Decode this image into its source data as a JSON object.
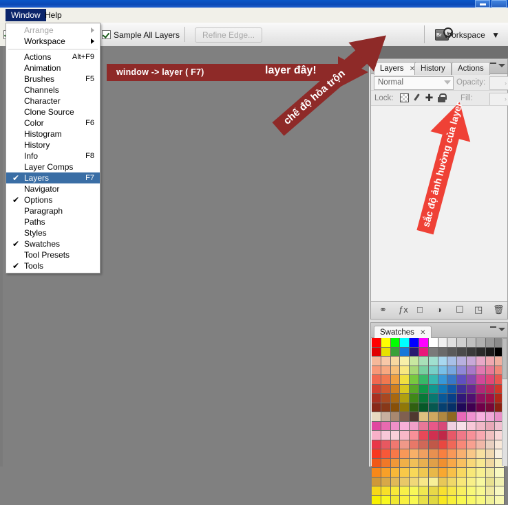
{
  "titlebar": {
    "restore_label": "",
    "close_label": ""
  },
  "menubar": {
    "items": [
      {
        "label": "Window",
        "active": true
      },
      {
        "label": "Help",
        "active": false
      }
    ]
  },
  "options_bar": {
    "sample_all_layers_label": "Sample All Layers",
    "sample_all_layers_checked": true,
    "refine_edge_label": "Refine Edge...",
    "refine_edge_disabled": true,
    "bridge_icon": "bridge-icon",
    "bridge_badge": "Br",
    "workspace_label": "Workspace",
    "workspace_caret": "chevron-down-icon"
  },
  "window_menu": {
    "items": [
      {
        "label": "Arrange",
        "shortcut": "",
        "checked": false,
        "disabled": true,
        "submenu": true,
        "selected": false
      },
      {
        "label": "Workspace",
        "shortcut": "",
        "checked": false,
        "disabled": false,
        "submenu": true,
        "selected": false
      },
      {
        "separator": true
      },
      {
        "label": "Actions",
        "shortcut": "Alt+F9",
        "checked": false,
        "disabled": false,
        "submenu": false,
        "selected": false
      },
      {
        "label": "Animation",
        "shortcut": "",
        "checked": false,
        "disabled": false,
        "submenu": false,
        "selected": false
      },
      {
        "label": "Brushes",
        "shortcut": "F5",
        "checked": false,
        "disabled": false,
        "submenu": false,
        "selected": false
      },
      {
        "label": "Channels",
        "shortcut": "",
        "checked": false,
        "disabled": false,
        "submenu": false,
        "selected": false
      },
      {
        "label": "Character",
        "shortcut": "",
        "checked": false,
        "disabled": false,
        "submenu": false,
        "selected": false
      },
      {
        "label": "Clone Source",
        "shortcut": "",
        "checked": false,
        "disabled": false,
        "submenu": false,
        "selected": false
      },
      {
        "label": "Color",
        "shortcut": "F6",
        "checked": false,
        "disabled": false,
        "submenu": false,
        "selected": false
      },
      {
        "label": "Histogram",
        "shortcut": "",
        "checked": false,
        "disabled": false,
        "submenu": false,
        "selected": false
      },
      {
        "label": "History",
        "shortcut": "",
        "checked": false,
        "disabled": false,
        "submenu": false,
        "selected": false
      },
      {
        "label": "Info",
        "shortcut": "F8",
        "checked": false,
        "disabled": false,
        "submenu": false,
        "selected": false
      },
      {
        "label": "Layer Comps",
        "shortcut": "",
        "checked": false,
        "disabled": false,
        "submenu": false,
        "selected": false
      },
      {
        "label": "Layers",
        "shortcut": "F7",
        "checked": true,
        "disabled": false,
        "submenu": false,
        "selected": true
      },
      {
        "label": "Navigator",
        "shortcut": "",
        "checked": false,
        "disabled": false,
        "submenu": false,
        "selected": false
      },
      {
        "label": "Options",
        "shortcut": "",
        "checked": true,
        "disabled": false,
        "submenu": false,
        "selected": false
      },
      {
        "label": "Paragraph",
        "shortcut": "",
        "checked": false,
        "disabled": false,
        "submenu": false,
        "selected": false
      },
      {
        "label": "Paths",
        "shortcut": "",
        "checked": false,
        "disabled": false,
        "submenu": false,
        "selected": false
      },
      {
        "label": "Styles",
        "shortcut": "",
        "checked": false,
        "disabled": false,
        "submenu": false,
        "selected": false
      },
      {
        "label": "Swatches",
        "shortcut": "",
        "checked": true,
        "disabled": false,
        "submenu": false,
        "selected": false
      },
      {
        "label": "Tool Presets",
        "shortcut": "",
        "checked": false,
        "disabled": false,
        "submenu": false,
        "selected": false
      },
      {
        "label": "Tools",
        "shortcut": "",
        "checked": true,
        "disabled": false,
        "submenu": false,
        "selected": false
      }
    ],
    "check_glyph": "✔"
  },
  "layers_panel": {
    "tabs": [
      {
        "label": "Layers",
        "active": true,
        "closable": true
      },
      {
        "label": "History",
        "active": false,
        "closable": false
      },
      {
        "label": "Actions",
        "active": false,
        "closable": false
      }
    ],
    "close_glyph": "✕",
    "blend_mode_value": "Normal",
    "opacity_label": "Opacity:",
    "opacity_value": "",
    "lock_label": "Lock:",
    "lock_icons": [
      "transparency-lock-icon",
      "image-lock-icon",
      "position-lock-icon",
      "all-lock-icon"
    ],
    "fill_label": "Fill:",
    "fill_value": "",
    "bottom_icons": [
      {
        "name": "link-layers-icon",
        "glyph": "⚭"
      },
      {
        "name": "layer-style-icon",
        "glyph": "ƒx"
      },
      {
        "name": "layer-mask-icon",
        "glyph": "□"
      },
      {
        "name": "adjustment-layer-icon",
        "glyph": "◑"
      },
      {
        "name": "new-group-icon",
        "glyph": "☐"
      },
      {
        "name": "new-layer-icon",
        "glyph": "◳"
      },
      {
        "name": "delete-layer-icon",
        "glyph": "🗑"
      }
    ]
  },
  "swatches_panel": {
    "tab_label": "Swatches",
    "close_glyph": "✕",
    "colors": [
      "#ff0000",
      "#ffff00",
      "#00ff00",
      "#00ffff",
      "#0000ff",
      "#ff00ff",
      "#ffffff",
      "#f0f0f0",
      "#e0e0e0",
      "#d0d0d0",
      "#c0c0c0",
      "#b0b0b0",
      "#9a9a9a",
      "#8a8a8a",
      "#e00000",
      "#e8e000",
      "#3aa03a",
      "#1878d8",
      "#2a1a70",
      "#e8187a",
      "#7a7a7a",
      "#6a6a6a",
      "#5a5a5a",
      "#4a4a4a",
      "#3a3a3a",
      "#2a2a2a",
      "#1a1a1a",
      "#000000",
      "#f6b89a",
      "#f8c8a8",
      "#f8d8a0",
      "#f8f0a8",
      "#c8e8a0",
      "#a8e0b8",
      "#a0e0d0",
      "#a8d8f0",
      "#a8c0e8",
      "#b8b0e0",
      "#c8a8d8",
      "#e8a8c8",
      "#f0a8b0",
      "#f0b0a0",
      "#f89878",
      "#f8a880",
      "#f8c078",
      "#f8e880",
      "#a8d878",
      "#78d0a0",
      "#78d0c8",
      "#78c0e8",
      "#78a8e0",
      "#9088d8",
      "#a878c8",
      "#e078b0",
      "#e87898",
      "#f08878",
      "#f06850",
      "#f07850",
      "#f0a040",
      "#f0e040",
      "#78c840",
      "#38b868",
      "#38b8b0",
      "#3898d8",
      "#3878c8",
      "#6050c0",
      "#8848b0",
      "#d04898",
      "#e04878",
      "#e85850",
      "#d04030",
      "#d05830",
      "#d08020",
      "#d8c820",
      "#58a828",
      "#109848",
      "#109890",
      "#1078b8",
      "#1058a8",
      "#403098",
      "#682890",
      "#b02878",
      "#c02858",
      "#d03828",
      "#a83020",
      "#a84820",
      "#a86810",
      "#b0a010",
      "#408818",
      "#087838",
      "#087870",
      "#085898",
      "#084088",
      "#301878",
      "#501070",
      "#901060",
      "#a01048",
      "#b02818",
      "#882818",
      "#883818",
      "#885008",
      "#907808",
      "#306010",
      "#065828",
      "#065850",
      "#064070",
      "#063068",
      "#200858",
      "#400050",
      "#700048",
      "#780838",
      "#882010",
      "#e8d8c0",
      "#c8b0a0",
      "#a88870",
      "#806050",
      "#503830",
      "#e0c080",
      "#d0a860",
      "#b08840",
      "#906820",
      "#e868b8",
      "#f090d0",
      "#f8b0e0",
      "#f0a8d8",
      "#e890c8",
      "#e048a0",
      "#e86ab0",
      "#f090c8",
      "#f8b0d8",
      "#f0a0c8",
      "#e87898",
      "#e85888",
      "#d84878",
      "#f0d0e0",
      "#f8e0e8",
      "#f8c8d8",
      "#f0b8c8",
      "#e8a8b8",
      "#f0c0d0",
      "#f8b0c8",
      "#f8c8d8",
      "#f8d0d8",
      "#f8b8c8",
      "#f89098",
      "#e84858",
      "#d03050",
      "#c02848",
      "#e85868",
      "#f07888",
      "#f89098",
      "#f8a8b0",
      "#f0c0c0",
      "#f8d8d8",
      "#e83848",
      "#e85860",
      "#f07870",
      "#f09888",
      "#e87868",
      "#d06858",
      "#c05848",
      "#e84840",
      "#f06858",
      "#f88878",
      "#f8a090",
      "#f0b8a8",
      "#e8d0c0",
      "#f8e8d8",
      "#f83820",
      "#f85838",
      "#f87848",
      "#f89858",
      "#f8b068",
      "#f0a060",
      "#e89050",
      "#f88040",
      "#f89858",
      "#f8b070",
      "#f8c888",
      "#f8e0a0",
      "#f0d8b0",
      "#f8f0e0",
      "#f05818",
      "#f07828",
      "#f09838",
      "#f0b048",
      "#f0c058",
      "#e8b050",
      "#e0a048",
      "#f09030",
      "#f8a848",
      "#f8c060",
      "#f8d878",
      "#f8e890",
      "#f0d8a0",
      "#f8f0c0",
      "#f88818",
      "#f8a028",
      "#f8b838",
      "#f8c848",
      "#f8d858",
      "#f0c850",
      "#e8b848",
      "#f8a830",
      "#f8c048",
      "#f8d860",
      "#f8e878",
      "#f8f090",
      "#f0e8a0",
      "#f8f8c0",
      "#d09838",
      "#d8a848",
      "#e0b858",
      "#e8c868",
      "#f0d878",
      "#f8e888",
      "#f8f098",
      "#e8c858",
      "#f0d868",
      "#f8e878",
      "#f8f088",
      "#f8f8a0",
      "#e8e090",
      "#f0f0b0",
      "#f8d818",
      "#f8e028",
      "#f8e838",
      "#f8f048",
      "#f8f858",
      "#f0e850",
      "#e8d848",
      "#f8e030",
      "#f8e848",
      "#f8f060",
      "#f8f878",
      "#f8f890",
      "#f0e8a0",
      "#f8f8c0",
      "#f8f000",
      "#f8f820",
      "#f0e830",
      "#f8f040",
      "#f8f850",
      "#e8e048",
      "#e0d840",
      "#f8e820",
      "#f8f038",
      "#f8f850",
      "#f8f868",
      "#f8f880",
      "#f0f098",
      "#f8f8b0"
    ]
  },
  "annotations": {
    "arrow_horizontal_text_left": "window -> layer ( F7)",
    "arrow_horizontal_text_right": "layer đây!",
    "arrow_diagonal_dark_text": "chế độ hòa trộn",
    "arrow_diagonal_red_text": "sắc độ ảnh hưởng của layer",
    "color_dark_red": "#8e2a28",
    "color_bright_red": "#ef4136"
  }
}
